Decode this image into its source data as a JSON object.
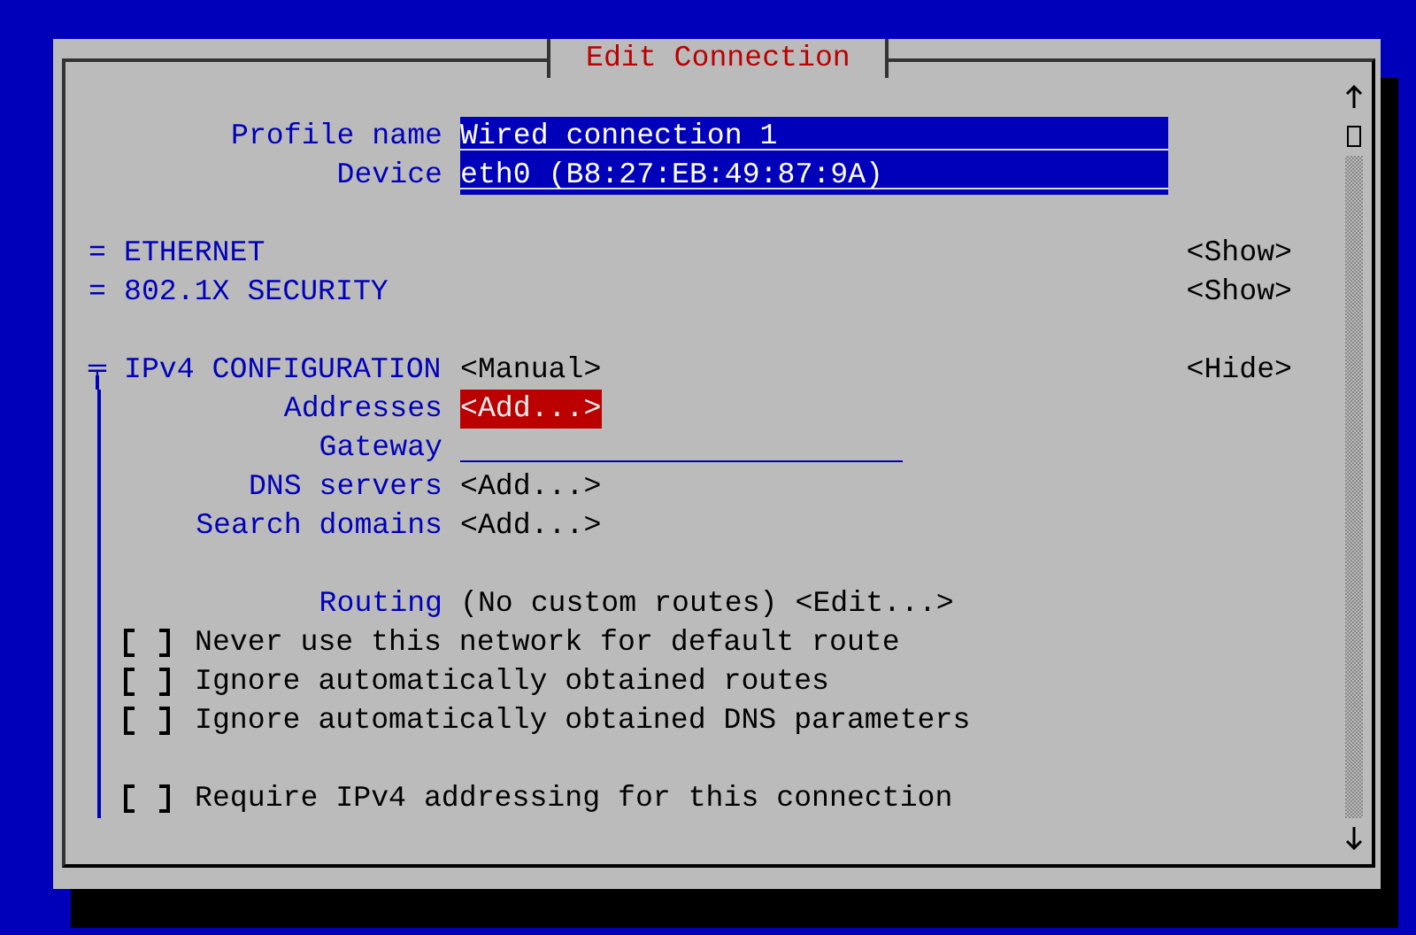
{
  "window": {
    "title": "Edit Connection"
  },
  "fields": [
    {
      "label": "Profile name",
      "value": "Wired connection 1"
    },
    {
      "label": "Device",
      "value": "eth0 (B8:27:EB:49:87:9A)"
    }
  ],
  "sections": [
    {
      "marker": "=",
      "title": "ETHERNET",
      "toggle": "<Show>",
      "expanded": false
    },
    {
      "marker": "=",
      "title": "802.1X SECURITY",
      "toggle": "<Show>",
      "expanded": false
    },
    {
      "marker": "╤",
      "title": "IPv4 CONFIGURATION",
      "method": "<Manual>",
      "toggle": "<Hide>",
      "expanded": true,
      "rows": [
        {
          "kind": "button",
          "label": "Addresses",
          "button": "<Add...>",
          "focused": true
        },
        {
          "kind": "field",
          "label": "Gateway"
        },
        {
          "kind": "button",
          "label": "DNS servers",
          "button": "<Add...>",
          "focused": false
        },
        {
          "kind": "button",
          "label": "Search domains",
          "button": "<Add...>",
          "focused": false
        }
      ],
      "routing": {
        "label": "Routing",
        "value": "(No custom routes)",
        "button": "<Edit...>"
      },
      "options": [
        {
          "label": "Never use this network for default route",
          "checked": false
        },
        {
          "label": "Ignore automatically obtained routes",
          "checked": false
        },
        {
          "label": "Ignore automatically obtained DNS parameters",
          "checked": false
        }
      ],
      "require": {
        "label": "Require IPv4 addressing for this connection",
        "checked": false
      }
    }
  ]
}
